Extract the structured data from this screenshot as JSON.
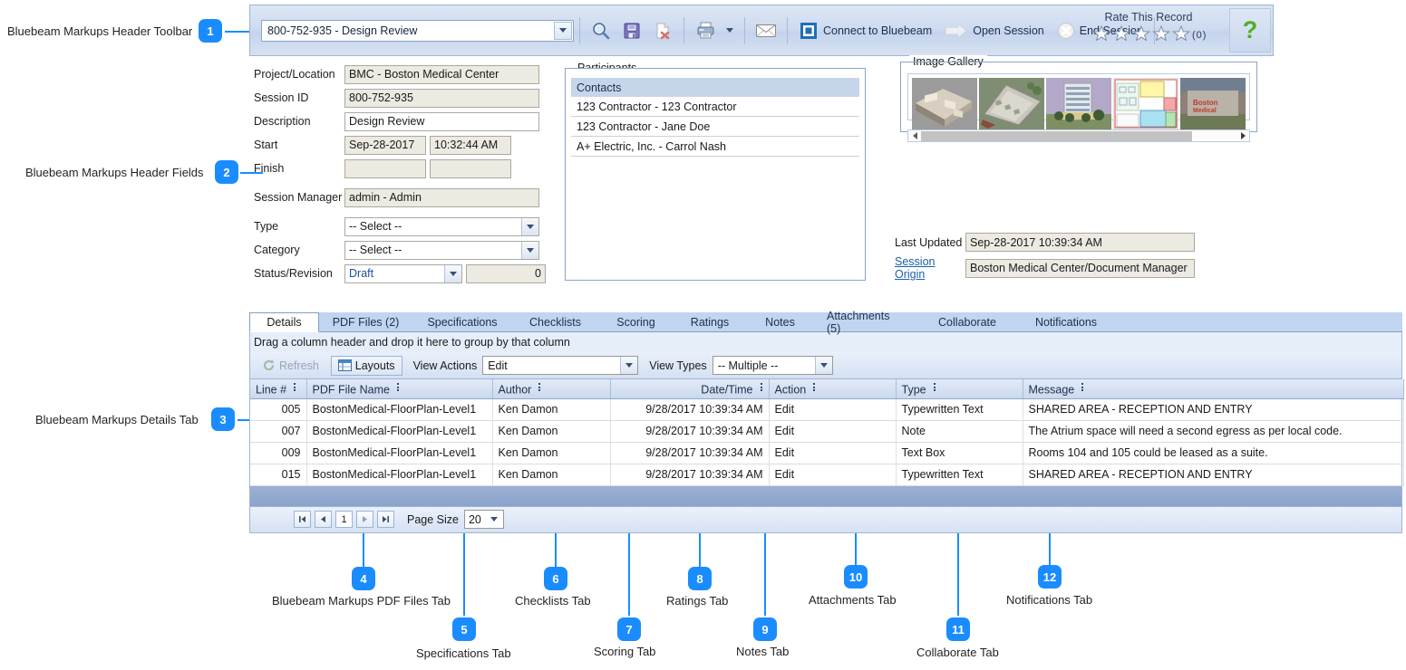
{
  "annotations": [
    {
      "n": "1",
      "label": "Bluebeam Markups Header Toolbar"
    },
    {
      "n": "2",
      "label": "Bluebeam Markups Header Fields"
    },
    {
      "n": "3",
      "label": "Bluebeam Markups Details Tab"
    },
    {
      "n": "4",
      "label": "Bluebeam Markups PDF Files Tab"
    },
    {
      "n": "5",
      "label": "Specifications Tab"
    },
    {
      "n": "6",
      "label": "Checklists Tab"
    },
    {
      "n": "7",
      "label": "Scoring Tab"
    },
    {
      "n": "8",
      "label": "Ratings Tab"
    },
    {
      "n": "9",
      "label": "Notes Tab"
    },
    {
      "n": "10",
      "label": "Attachments Tab"
    },
    {
      "n": "11",
      "label": "Collaborate Tab"
    },
    {
      "n": "12",
      "label": "Notifications Tab"
    }
  ],
  "toolbar": {
    "session_selected": "800-752-935 - Design Review",
    "icons": [
      "search-icon",
      "save-icon",
      "delete-document-icon",
      "print-icon",
      "print-dropdown-icon",
      "email-icon"
    ],
    "connect_label": "Connect to Bluebeam",
    "open_session_label": "Open Session",
    "end_session_label": "End Session",
    "rate_title": "Rate This Record",
    "rate_count": "(0)",
    "rate_stars": 5,
    "help_glyph": "?"
  },
  "header_fields": {
    "project_location": {
      "label": "Project/Location",
      "value": "BMC - Boston Medical Center"
    },
    "session_id": {
      "label": "Session ID",
      "value": "800-752-935"
    },
    "description": {
      "label": "Description",
      "value": "Design Review"
    },
    "start": {
      "label": "Start",
      "date": "Sep-28-2017",
      "time": "10:32:44 AM"
    },
    "finish": {
      "label": "Finish",
      "date": "",
      "time": ""
    },
    "session_manager": {
      "label": "Session Manager",
      "value": "admin - Admin"
    },
    "type": {
      "label": "Type",
      "value": "-- Select --"
    },
    "category": {
      "label": "Category",
      "value": "-- Select --"
    },
    "status_revision": {
      "label": "Status/Revision",
      "status": "Draft",
      "revision": "0"
    }
  },
  "participants": {
    "legend": "Participants",
    "column_header": "Contacts",
    "rows": [
      "123 Contractor - 123 Contractor",
      "123 Contractor - Jane Doe",
      "A+ Electric, Inc. - Carrol Nash"
    ]
  },
  "gallery": {
    "legend": "Image Gallery",
    "thumbnails": [
      "floorplan-3d-render",
      "apartment-complex-aerial",
      "highrise-building-render",
      "color-coded-floorplan",
      "boston-medical-signage"
    ],
    "scroll_left_icon": "triangle-left-icon",
    "scroll_right_icon": "triangle-right-icon"
  },
  "meta": {
    "last_updated_label": "Last Updated",
    "last_updated_value": "Sep-28-2017 10:39:34 AM",
    "session_origin_label": "Session Origin",
    "session_origin_value": "Boston Medical Center/Document Manager"
  },
  "tabs": [
    {
      "label": "Details",
      "active": true
    },
    {
      "label": "PDF Files (2)",
      "active": false
    },
    {
      "label": "Specifications",
      "active": false
    },
    {
      "label": "Checklists",
      "active": false
    },
    {
      "label": "Scoring",
      "active": false
    },
    {
      "label": "Ratings",
      "active": false
    },
    {
      "label": "Notes",
      "active": false
    },
    {
      "label": "Attachments (5)",
      "active": false
    },
    {
      "label": "Collaborate",
      "active": false
    },
    {
      "label": "Notifications",
      "active": false
    }
  ],
  "grid": {
    "group_hint": "Drag a column header and drop it here to group by that column",
    "refresh_label": "Refresh",
    "layouts_label": "Layouts",
    "view_actions_label": "View Actions",
    "view_actions_value": "Edit",
    "view_types_label": "View Types",
    "view_types_value": "-- Multiple --",
    "columns": [
      "Line #",
      "PDF File Name",
      "Author",
      "Date/Time",
      "Action",
      "Type",
      "Message"
    ],
    "rows": [
      {
        "line": "005",
        "file": "BostonMedical-FloorPlan-Level1",
        "author": "Ken Damon",
        "datetime": "9/28/2017 10:39:34 AM",
        "action": "Edit",
        "type": "Typewritten Text",
        "message": "SHARED AREA - RECEPTION AND ENTRY"
      },
      {
        "line": "007",
        "file": "BostonMedical-FloorPlan-Level1",
        "author": "Ken Damon",
        "datetime": "9/28/2017 10:39:34 AM",
        "action": "Edit",
        "type": "Note",
        "message": "The Atrium space will need a second egress as per local code."
      },
      {
        "line": "009",
        "file": "BostonMedical-FloorPlan-Level1",
        "author": "Ken Damon",
        "datetime": "9/28/2017 10:39:34 AM",
        "action": "Edit",
        "type": "Text Box",
        "message": "Rooms 104 and 105 could be leased as a suite."
      },
      {
        "line": "015",
        "file": "BostonMedical-FloorPlan-Level1",
        "author": "Ken Damon",
        "datetime": "9/28/2017 10:39:34 AM",
        "action": "Edit",
        "type": "Typewritten Text",
        "message": "SHARED AREA - RECEPTION AND ENTRY"
      }
    ],
    "pager": {
      "first": "|◀",
      "prev": "◀",
      "page": "1",
      "next": "▶",
      "last": "▶|",
      "page_size_label": "Page Size",
      "page_size_value": "20"
    }
  },
  "colors": {
    "accent": "#1a8cff",
    "toolbar_bg": "#cfdcf0",
    "tab_strip": "#c1d5f0",
    "field_readonly": "#eceae1",
    "link": "#1b5faa",
    "help_green": "#4caf22"
  }
}
